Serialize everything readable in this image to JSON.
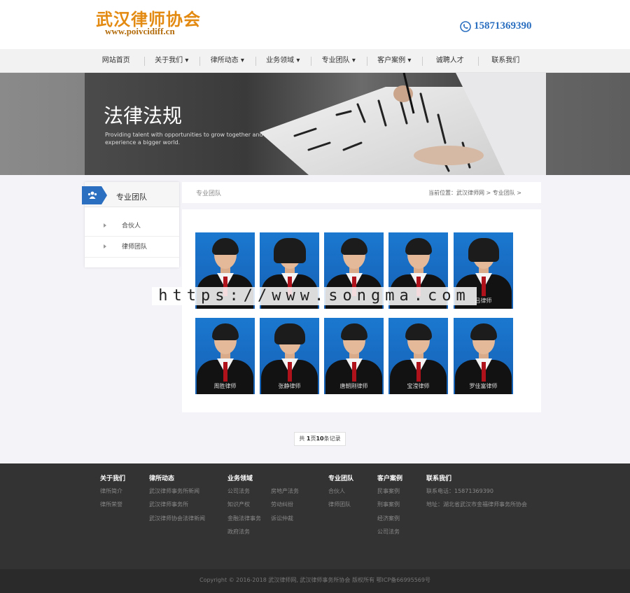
{
  "header": {
    "logo_cn": "武汉律师协会",
    "logo_en": "www.poivcidiff.cn",
    "phone": "15871369390"
  },
  "nav": [
    "网站首页",
    "关于我们 ▾",
    "律所动态 ▾",
    "业务领域 ▾",
    "专业团队 ▾",
    "客户案例 ▾",
    "诚聘人才",
    "联系我们"
  ],
  "banner": {
    "title": "法律法规",
    "subtitle": "Providing talent with opportunities to grow together and experience a bigger world."
  },
  "sidebar": {
    "title": "专业团队",
    "items": [
      "合伙人",
      "律师团队"
    ]
  },
  "breadcrumb": {
    "section": "专业团队",
    "path": "当前位置：武汉律师网 > 专业团队 >"
  },
  "lawyers": [
    {
      "name": ""
    },
    {
      "name": ""
    },
    {
      "name": ""
    },
    {
      "name": ""
    },
    {
      "name": "吕律师"
    },
    {
      "name": "周胜律师"
    },
    {
      "name": "张静律师"
    },
    {
      "name": "唐朝刚律师"
    },
    {
      "name": "宝滢律师"
    },
    {
      "name": "罗佳富律师"
    }
  ],
  "watermark": "https://www.songma.com",
  "pager": {
    "prefix": "共 ",
    "pages": "1",
    "mid": "页",
    "records": "10",
    "suffix": "条记录"
  },
  "footer": {
    "columns": [
      {
        "title": "关于我们",
        "links": [
          "律所简介",
          "律所荣誉"
        ]
      },
      {
        "title": "律所动态",
        "links": [
          "武汉律师事务所新闻",
          "武汉律师事务所",
          "武汉律师协会法律新闻"
        ]
      },
      {
        "title": "业务领域",
        "links": [
          "公司法务",
          "知识产权",
          "金融法律事务",
          "政府法务"
        ]
      },
      {
        "title": "",
        "links": [
          "房地产法务",
          "劳动纠纷",
          "诉讼仲裁"
        ]
      },
      {
        "title": "专业团队",
        "links": [
          "合伙人",
          "律师团队"
        ]
      },
      {
        "title": "客户案例",
        "links": [
          "民事案例",
          "刑事案例",
          "经济案例",
          "公司法务"
        ]
      },
      {
        "title": "联系我们",
        "links": [
          "联系电话：15871369390",
          "地址：湖北省武汉市金福律师事务所协会"
        ]
      }
    ],
    "copyright": "Copyright © 2016-2018 武汉律师网, 武汉律师事务所协会 版权所有 鄂ICP备66995569号"
  }
}
